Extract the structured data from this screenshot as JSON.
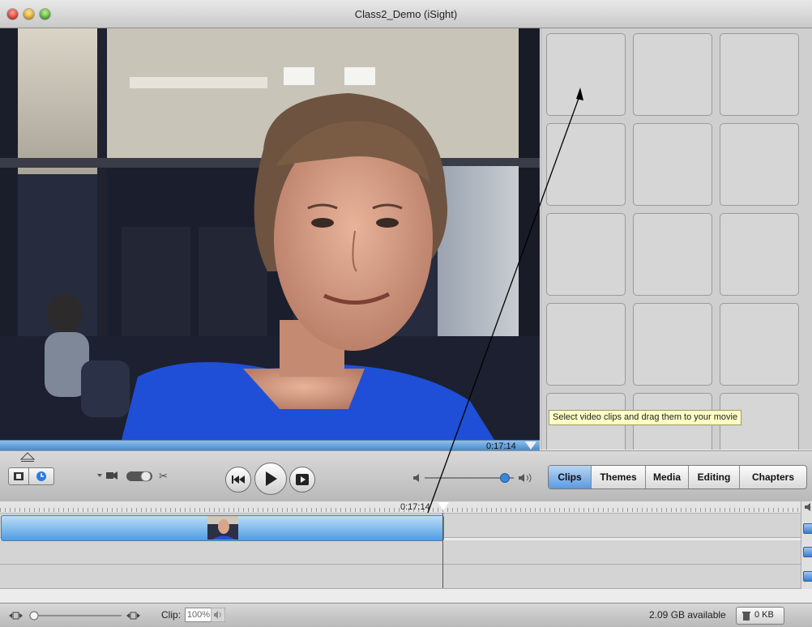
{
  "window": {
    "title": "Class2_Demo (iSight)"
  },
  "viewer": {
    "timecode": "0:17:14"
  },
  "tooltip": "Select video clips and drag them to your movie",
  "toolbar": {
    "tabs": [
      "Clips",
      "Themes",
      "Media",
      "Editing",
      "Chapters"
    ],
    "active_tab": "Clips",
    "volume_level": 0.9
  },
  "timeline": {
    "timecode": "0:17:14"
  },
  "status": {
    "clip_label": "Clip:",
    "clip_volume": "100%",
    "disk_available": "2.09 GB available",
    "trash_size": "0 KB"
  },
  "colors": {
    "accent": "#5b9ae0",
    "clip": "#4f9de3",
    "tooltip": "#ffffc6"
  }
}
